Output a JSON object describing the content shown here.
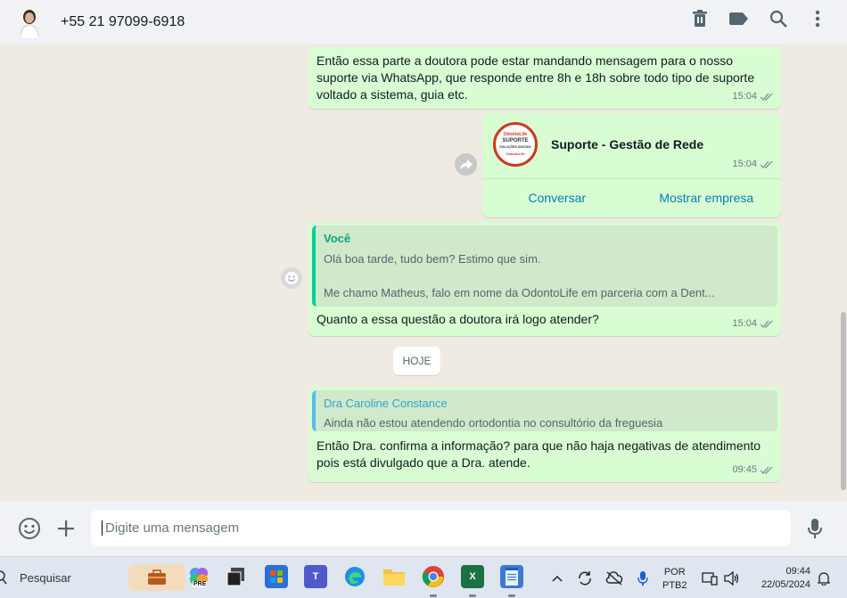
{
  "header": {
    "contact_name": "+55 21 97099-6918",
    "icons": [
      "delete-icon",
      "label-icon",
      "search-icon",
      "menu-icon"
    ]
  },
  "messages": [
    {
      "text": "Então essa parte a doutora pode estar mandando mensagem para o nosso suporte via WhatsApp, que responde entre 8h e 18h sobre todo tipo de suporte voltado a sistema, guia etc.",
      "time": "15:04"
    },
    {
      "contact_card": {
        "name": "Suporte - Gestão de Rede",
        "logo_text": [
          "OdontoLife",
          "SUPORTE",
          "SOLUÇÕES DIGITAIS",
          "OdontoLife"
        ],
        "time": "15:04",
        "action_message": "Conversar",
        "action_view": "Mostrar empresa"
      }
    },
    {
      "quote_author": "Você",
      "quote_line1": "Olá boa tarde, tudo bem? Estimo que sim.",
      "quote_line2": "Me chamo Matheus, falo em nome da OdontoLife em parceria com a Dent...",
      "text": "Quanto a essa questão a doutora irá logo atender?",
      "time": "15:04"
    },
    {
      "quote_author": "Dra Caroline Constance",
      "quote_line1": "Ainda não estou atendendo ortodontia no consultório da freguesia",
      "text": "Então Dra. confirma a informação? para que não haja negativas de atendimento pois está divulgado que a Dra. atende.",
      "time": "09:45"
    }
  ],
  "day_separator": "HOJE",
  "composer": {
    "placeholder": "Digite uma mensagem"
  },
  "taskbar": {
    "search_label": "Pesquisar",
    "apps": [
      "widgets",
      "copilot",
      "task-view",
      "store",
      "teams",
      "edge",
      "explorer",
      "chrome",
      "excel",
      "notepad"
    ],
    "copilot_badge": "PRE",
    "language_line1": "POR",
    "language_line2": "PTB2",
    "time": "09:44",
    "date": "22/05/2024"
  },
  "colors": {
    "outgoing_bubble": "#d9fdd3",
    "chat_background": "#efeae2",
    "link": "#027eb5",
    "quote_self": "#06cf9c",
    "quote_other": "#53bdeb"
  }
}
